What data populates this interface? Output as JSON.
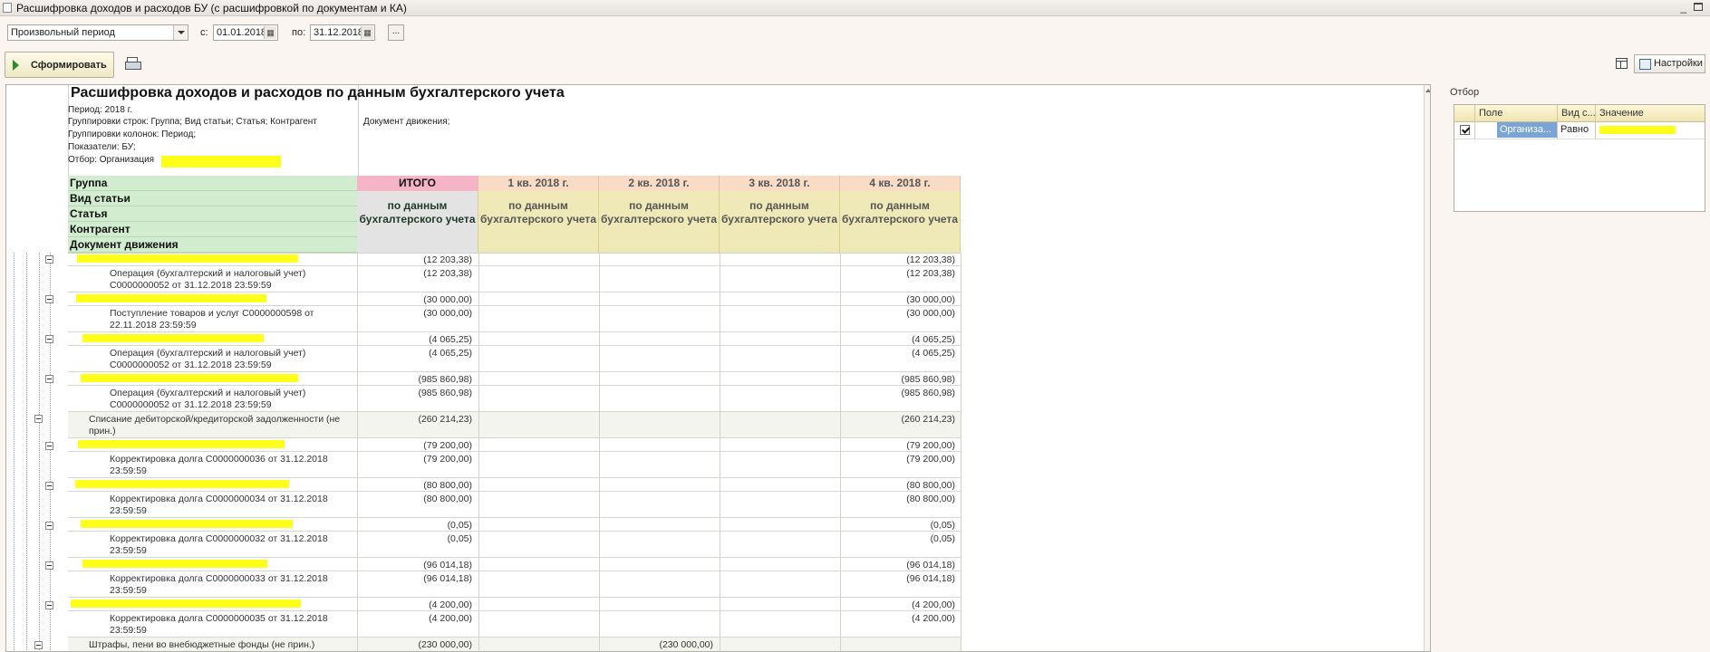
{
  "window": {
    "title": "Расшифровка доходов и расходов БУ (с расшифровкой по документам и КА)",
    "minimize": "_"
  },
  "toolbar": {
    "period_type": "Произвольный период",
    "from_label": "с:",
    "from_date": "01.01.2018",
    "to_label": "по:",
    "to_date": "31.12.2018",
    "ellipsis": "...",
    "generate_label": "Сформировать",
    "settings_label": "Настройки",
    "calendar_icon": "calendar-icon"
  },
  "report": {
    "title": "Расшифровка доходов и расходов по данным бухгалтерского учета",
    "period": "Период: 2018 г.",
    "row_groupings": "Группировки строк: Группа; Вид статьи; Статья; Контрагент",
    "row_groupings_tail": "Документ движения;",
    "column_groupings": "Группировки колонок: Период;",
    "indicators": "Показатели: БУ;",
    "filter": "Отбор: Организация",
    "group_headers": [
      "Группа",
      "Вид статьи",
      "Статья",
      "Контрагент",
      "Документ движения"
    ],
    "columns": [
      "ИТОГО",
      "1 кв. 2018 г.",
      "2 кв. 2018 г.",
      "3 кв. 2018 г.",
      "4 кв. 2018 г."
    ],
    "subheader": "по данным бухгалтерского учета",
    "rows": [
      {
        "kind": "counterparty",
        "label": "",
        "values": [
          "(12 203,38)",
          "",
          "",
          "",
          "(12 203,38)"
        ]
      },
      {
        "kind": "document",
        "label": "Операция (бухгалтерский и налоговый учет) С0000000052 от 31.12.2018 23:59:59",
        "values": [
          "(12 203,38)",
          "",
          "",
          "",
          "(12 203,38)"
        ]
      },
      {
        "kind": "counterparty",
        "label": "",
        "values": [
          "(30 000,00)",
          "",
          "",
          "",
          "(30 000,00)"
        ]
      },
      {
        "kind": "document",
        "label": "Поступление товаров и услуг С0000000598 от 22.11.2018 23:59:59",
        "values": [
          "(30 000,00)",
          "",
          "",
          "",
          "(30 000,00)"
        ]
      },
      {
        "kind": "counterparty",
        "label": "",
        "values": [
          "(4 065,25)",
          "",
          "",
          "",
          "(4 065,25)"
        ]
      },
      {
        "kind": "document",
        "label": "Операция (бухгалтерский и налоговый учет) С0000000052 от 31.12.2018 23:59:59",
        "values": [
          "(4 065,25)",
          "",
          "",
          "",
          "(4 065,25)"
        ]
      },
      {
        "kind": "counterparty",
        "label": "",
        "values": [
          "(985 860,98)",
          "",
          "",
          "",
          "(985 860,98)"
        ]
      },
      {
        "kind": "document",
        "label": "Операция (бухгалтерский и налоговый учет) С0000000052 от 31.12.2018 23:59:59",
        "values": [
          "(985 860,98)",
          "",
          "",
          "",
          "(985 860,98)"
        ]
      },
      {
        "kind": "article",
        "label": "Списание дебиторской/кредиторской задолженности (не прин.)",
        "values": [
          "(260 214,23)",
          "",
          "",
          "",
          "(260 214,23)"
        ]
      },
      {
        "kind": "counterparty",
        "label": "",
        "values": [
          "(79 200,00)",
          "",
          "",
          "",
          "(79 200,00)"
        ]
      },
      {
        "kind": "document",
        "label": "Корректировка долга С0000000036 от 31.12.2018 23:59:59",
        "values": [
          "(79 200,00)",
          "",
          "",
          "",
          "(79 200,00)"
        ]
      },
      {
        "kind": "counterparty",
        "label": "",
        "values": [
          "(80 800,00)",
          "",
          "",
          "",
          "(80 800,00)"
        ]
      },
      {
        "kind": "document",
        "label": "Корректировка долга С0000000034 от 31.12.2018 23:59:59",
        "values": [
          "(80 800,00)",
          "",
          "",
          "",
          "(80 800,00)"
        ]
      },
      {
        "kind": "counterparty",
        "label": "",
        "values": [
          "(0,05)",
          "",
          "",
          "",
          "(0,05)"
        ]
      },
      {
        "kind": "document",
        "label": "Корректировка долга С0000000032 от 31.12.2018 23:59:59",
        "values": [
          "(0,05)",
          "",
          "",
          "",
          "(0,05)"
        ]
      },
      {
        "kind": "counterparty",
        "label": "",
        "values": [
          "(96 014,18)",
          "",
          "",
          "",
          "(96 014,18)"
        ]
      },
      {
        "kind": "document",
        "label": "Корректировка долга С0000000033 от 31.12.2018 23:59:59",
        "values": [
          "(96 014,18)",
          "",
          "",
          "",
          "(96 014,18)"
        ]
      },
      {
        "kind": "counterparty",
        "label": "",
        "values": [
          "(4 200,00)",
          "",
          "",
          "",
          "(4 200,00)"
        ]
      },
      {
        "kind": "document",
        "label": "Корректировка долга С0000000035 от 31.12.2018 23:59:59",
        "values": [
          "(4 200,00)",
          "",
          "",
          "",
          "(4 200,00)"
        ]
      },
      {
        "kind": "article",
        "label": "Штрафы, пени во внебюджетные фонды (не прин.)",
        "values": [
          "(230 000,00)",
          "",
          "(230 000,00)",
          "",
          ""
        ]
      }
    ]
  },
  "filter_panel": {
    "title": "Отбор",
    "headers": [
      "Поле",
      "Вид с...",
      "Значение"
    ],
    "row": {
      "checked": true,
      "field": "Организа...",
      "comparison": "Равно",
      "value": ""
    }
  },
  "colors": {
    "highlight": "#ffff19",
    "group_header_bg": "#d2ecd0",
    "total_header_bg": "#f5b5c6",
    "quarter_header_bg": "#f9dcc6",
    "subheader_bg": "#efe9b8",
    "total_subheader_bg": "#e3e3e3"
  }
}
